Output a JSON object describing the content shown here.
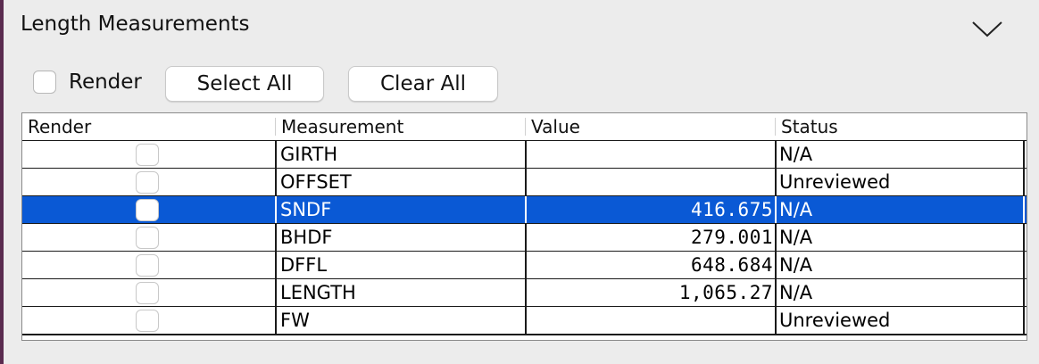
{
  "panel": {
    "title": "Length Measurements",
    "collapse_icon": "chevron-down-icon"
  },
  "toolbar": {
    "render_label": "Render",
    "render_checked": false,
    "select_all_label": "Select All",
    "clear_all_label": "Clear All"
  },
  "table": {
    "columns": [
      "Render",
      "Measurement",
      "Value",
      "Status"
    ],
    "rows": [
      {
        "render": false,
        "measurement": "GIRTH",
        "value": "",
        "status": "N/A",
        "selected": false
      },
      {
        "render": false,
        "measurement": "OFFSET",
        "value": "",
        "status": "Unreviewed",
        "selected": false
      },
      {
        "render": false,
        "measurement": "SNDF",
        "value": "416.675",
        "status": "N/A",
        "selected": true
      },
      {
        "render": false,
        "measurement": "BHDF",
        "value": "279.001",
        "status": "N/A",
        "selected": false
      },
      {
        "render": false,
        "measurement": "DFFL",
        "value": "648.684",
        "status": "N/A",
        "selected": false
      },
      {
        "render": false,
        "measurement": "LENGTH",
        "value": "1,065.27",
        "status": "N/A",
        "selected": false
      },
      {
        "render": false,
        "measurement": "FW",
        "value": "",
        "status": "Unreviewed",
        "selected": false
      }
    ]
  },
  "colors": {
    "selection": "#0a59d5",
    "panel_background": "#ececec",
    "left_accent": "#5a2b4f"
  }
}
